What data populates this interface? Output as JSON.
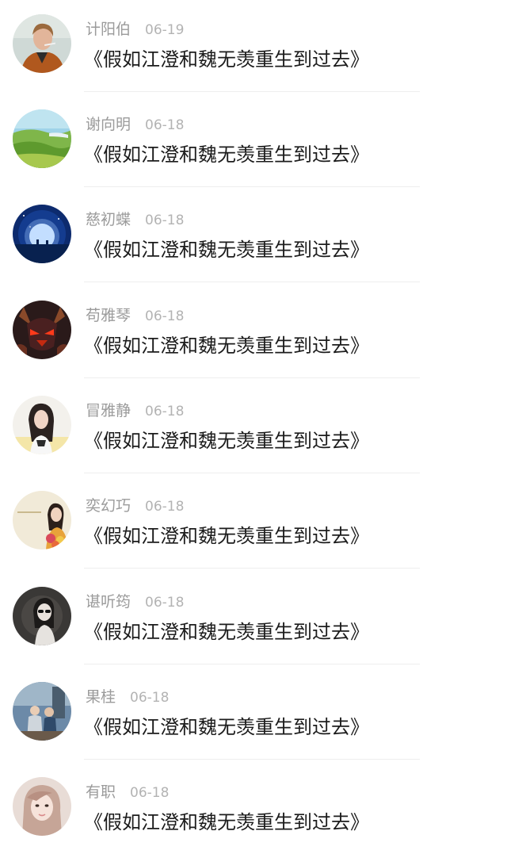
{
  "conversations": [
    {
      "name": "计阳伯",
      "date": "06-19",
      "message": "《假如江澄和魏无羡重生到过去》",
      "avatar_icon": "man-portrait-avatar"
    },
    {
      "name": "谢向明",
      "date": "06-18",
      "message": "《假如江澄和魏无羡重生到过去》",
      "avatar_icon": "landscape-avatar"
    },
    {
      "name": "慈初蝶",
      "date": "06-18",
      "message": "《假如江澄和魏无羡重生到过去》",
      "avatar_icon": "moon-night-avatar"
    },
    {
      "name": "苟雅琴",
      "date": "06-18",
      "message": "《假如江澄和魏无羡重生到过去》",
      "avatar_icon": "game-character-avatar"
    },
    {
      "name": "冒雅静",
      "date": "06-18",
      "message": "《假如江澄和魏无羡重生到过去》",
      "avatar_icon": "girl-portrait-avatar"
    },
    {
      "name": "奕幻巧",
      "date": "06-18",
      "message": "《假如江澄和魏无羡重生到过去》",
      "avatar_icon": "girl-with-flowers-avatar"
    },
    {
      "name": "谌听筠",
      "date": "06-18",
      "message": "《假如江澄和魏无羡重生到过去》",
      "avatar_icon": "girl-sunglasses-avatar"
    },
    {
      "name": "果桂",
      "date": "06-18",
      "message": "《假如江澄和魏无羡重生到过去》",
      "avatar_icon": "couple-photo-avatar"
    },
    {
      "name": "有职",
      "date": "06-18",
      "message": "《假如江澄和魏无羡重生到过去》",
      "avatar_icon": "girl-selfie-avatar"
    }
  ]
}
